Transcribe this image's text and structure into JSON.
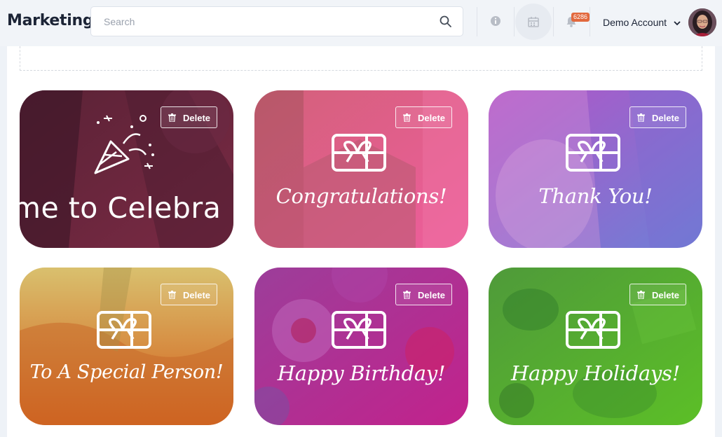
{
  "app": {
    "title": "Marketing"
  },
  "search": {
    "placeholder": "Search"
  },
  "header": {
    "notification_count": "6286",
    "account_label": "Demo Account"
  },
  "cards": [
    {
      "title": "me to Celebra",
      "delete_label": "Delete",
      "color_start": "#5a2236",
      "color_end": "#7a2a44"
    },
    {
      "title": "Congratulations!",
      "delete_label": "Delete",
      "color_start": "#d3607a",
      "color_end": "#ee5e9c"
    },
    {
      "title": "Thank You!",
      "delete_label": "Delete",
      "color_start": "#b255c7",
      "color_end": "#6e7fd6"
    },
    {
      "title": "To A Special Person!",
      "delete_label": "Delete",
      "color_start": "#d9c06e",
      "color_end": "#d45c18"
    },
    {
      "title": "Happy Birthday!",
      "delete_label": "Delete",
      "color_start": "#9c3e9a",
      "color_end": "#c2228c"
    },
    {
      "title": "Happy Holidays!",
      "delete_label": "Delete",
      "color_start": "#4f9a3a",
      "color_end": "#5cbf27"
    }
  ]
}
